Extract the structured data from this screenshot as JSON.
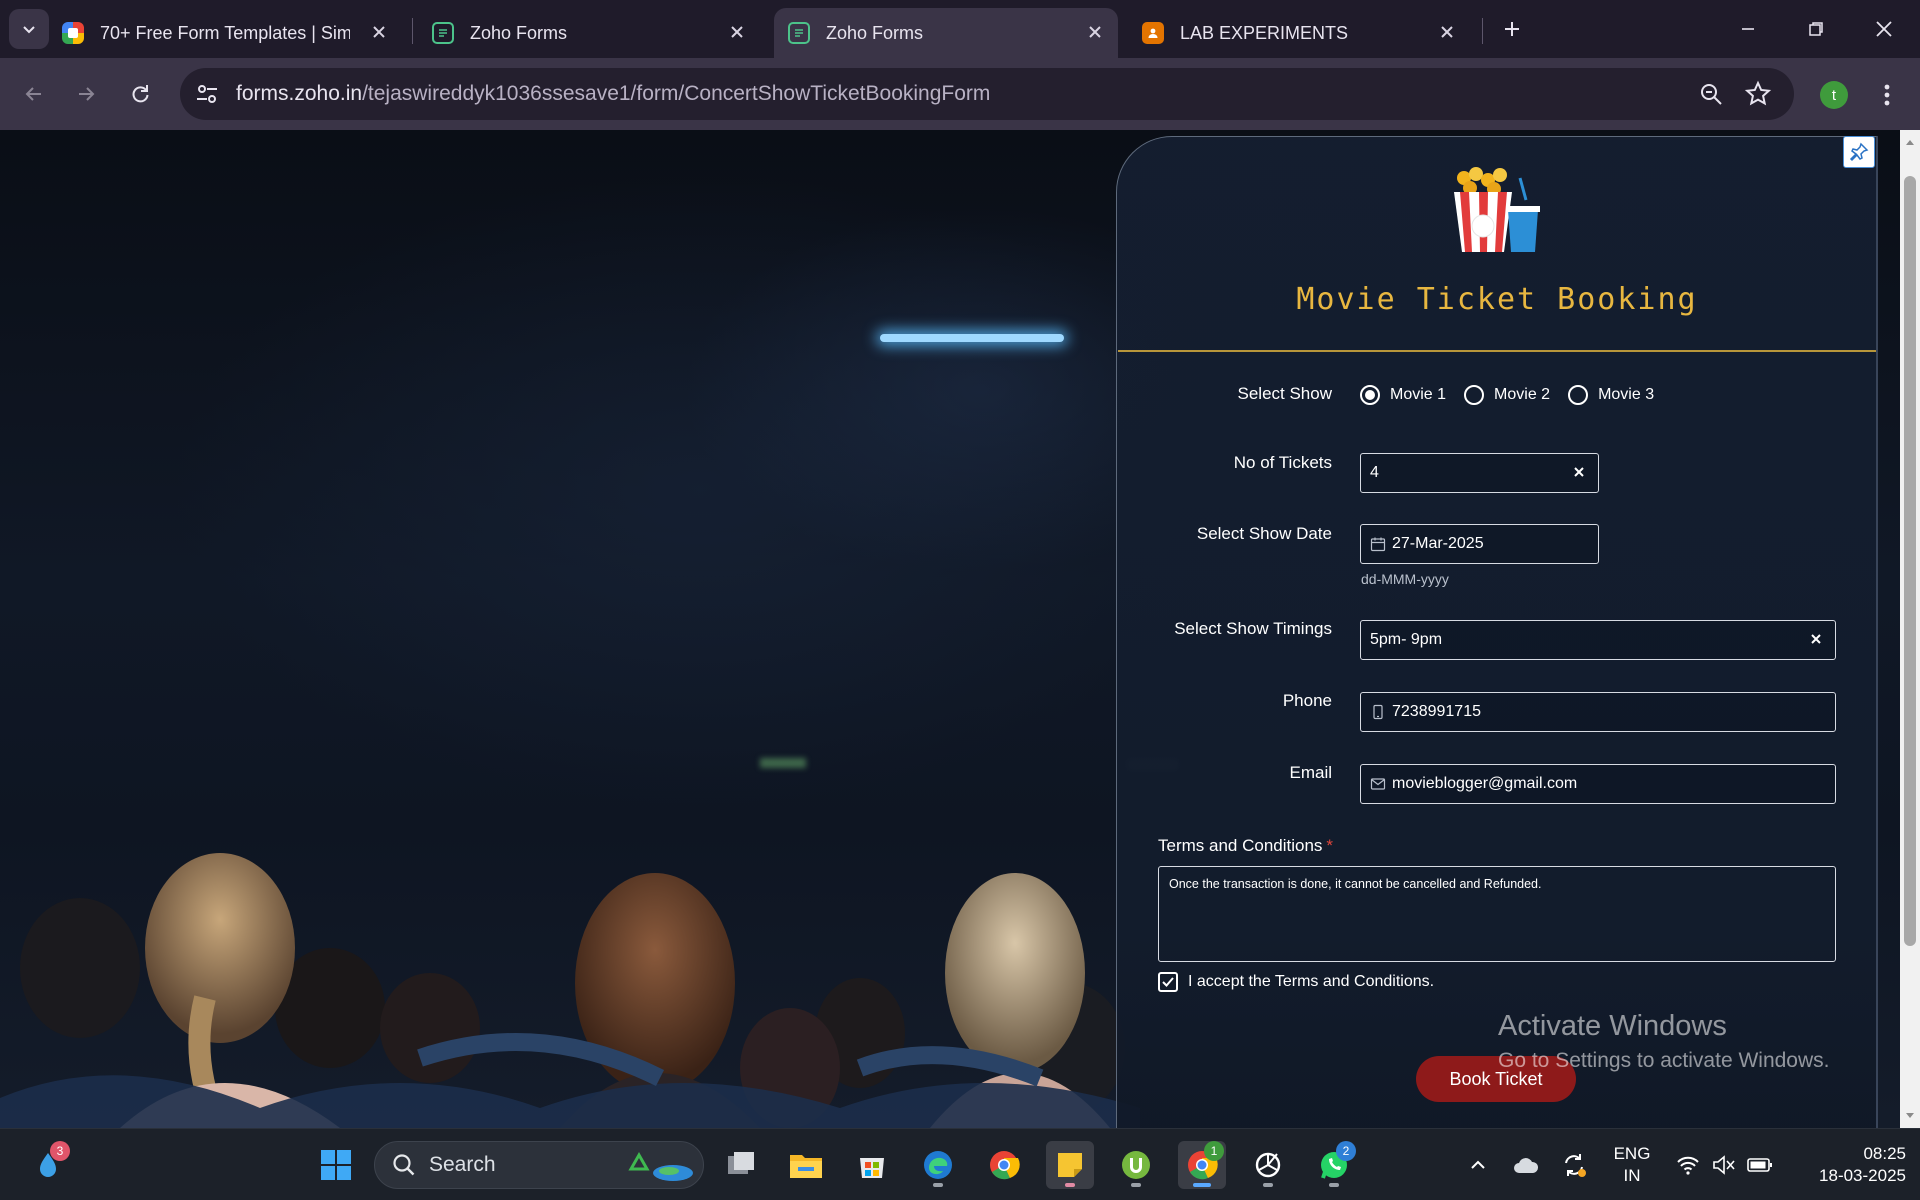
{
  "browser": {
    "tabs": [
      {
        "title": "70+ Free Form Templates | Simp",
        "active": false
      },
      {
        "title": "Zoho Forms",
        "active": false
      },
      {
        "title": "Zoho Forms",
        "active": true
      },
      {
        "title": "LAB EXPERIMENTS",
        "active": false
      }
    ],
    "url_host": "forms.zoho.in",
    "url_path": "/tejaswireddyk1036ssesave1/form/ConcertShowTicketBookingForm",
    "profile_initial": "t"
  },
  "form": {
    "title": "Movie Ticket Booking",
    "select_show": {
      "label": "Select Show",
      "options": [
        "Movie 1",
        "Movie 2",
        "Movie 3"
      ],
      "selected": "Movie 1"
    },
    "tickets": {
      "label": "No of Tickets",
      "value": "4"
    },
    "show_date": {
      "label": "Select Show Date",
      "value": "27-Mar-2025",
      "hint": "dd-MMM-yyyy"
    },
    "show_timings": {
      "label": "Select Show Timings",
      "value": "5pm- 9pm"
    },
    "phone": {
      "label": "Phone",
      "value": "7238991715"
    },
    "email": {
      "label": "Email",
      "value": "movieblogger@gmail.com"
    },
    "terms": {
      "label": "Terms and Conditions",
      "required_mark": "*",
      "text": "Once the transaction is done, it cannot be cancelled and Refunded.",
      "accept_label": "I accept the Terms and Conditions.",
      "accepted": true
    },
    "submit_label": "Book Ticket"
  },
  "watermark": {
    "line1": "Activate Windows",
    "line2": "Go to Settings to activate Windows."
  },
  "taskbar": {
    "widgets_badge": "3",
    "search_label": "Search",
    "chrome_badge": "1",
    "whatsapp_badge": "2",
    "language_line1": "ENG",
    "language_line2": "IN",
    "time": "08:25",
    "date": "18-03-2025"
  },
  "colors": {
    "title_gold": "#e8b740",
    "button_red": "#8e1a1a",
    "divider_gold": "#b8963a"
  }
}
